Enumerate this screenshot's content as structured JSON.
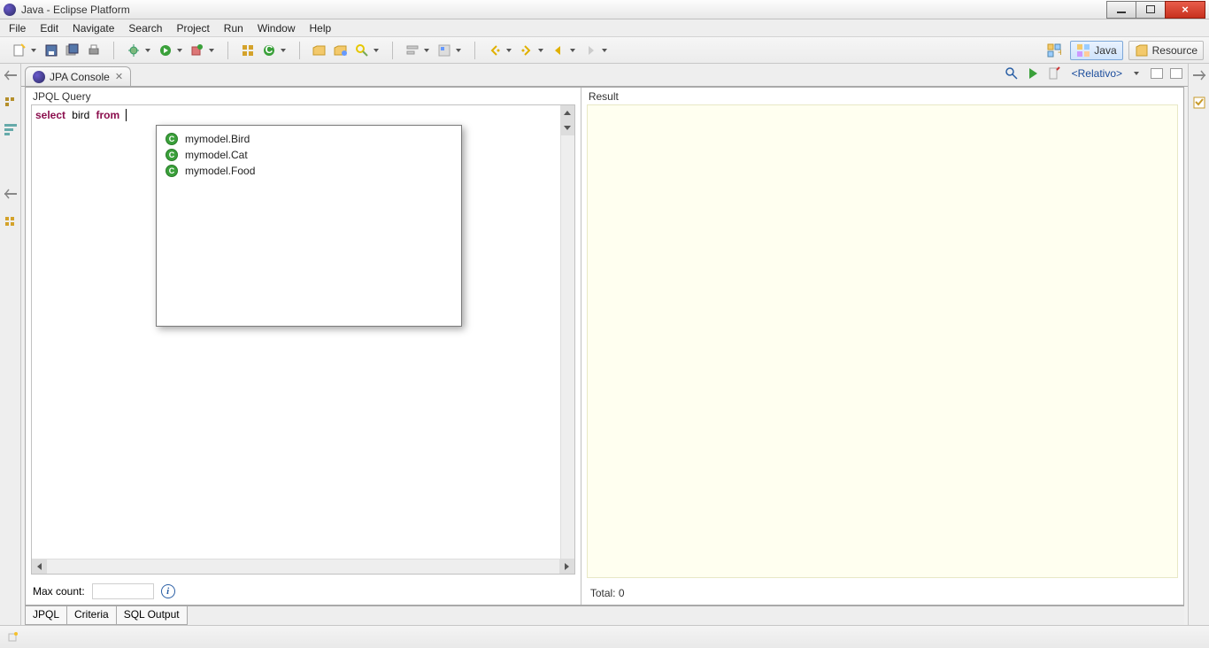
{
  "window": {
    "title": "Java - Eclipse Platform"
  },
  "menu": {
    "items": [
      "File",
      "Edit",
      "Navigate",
      "Search",
      "Project",
      "Run",
      "Window",
      "Help"
    ]
  },
  "perspectives": {
    "java": "Java",
    "resource": "Resource"
  },
  "view_tab": {
    "label": "JPA Console",
    "relativo": "<Relativo>"
  },
  "query_pane": {
    "header": "JPQL Query",
    "kw_select": "select",
    "ident": "bird",
    "kw_from": "from",
    "max_count_label": "Max count:",
    "max_count_value": ""
  },
  "result_pane": {
    "header": "Result",
    "total_label": "Total: 0"
  },
  "content_assist": {
    "items": [
      "mymodel.Bird",
      "mymodel.Cat",
      "mymodel.Food"
    ]
  },
  "inner_tabs": [
    "JPQL",
    "Criteria",
    "SQL Output"
  ]
}
